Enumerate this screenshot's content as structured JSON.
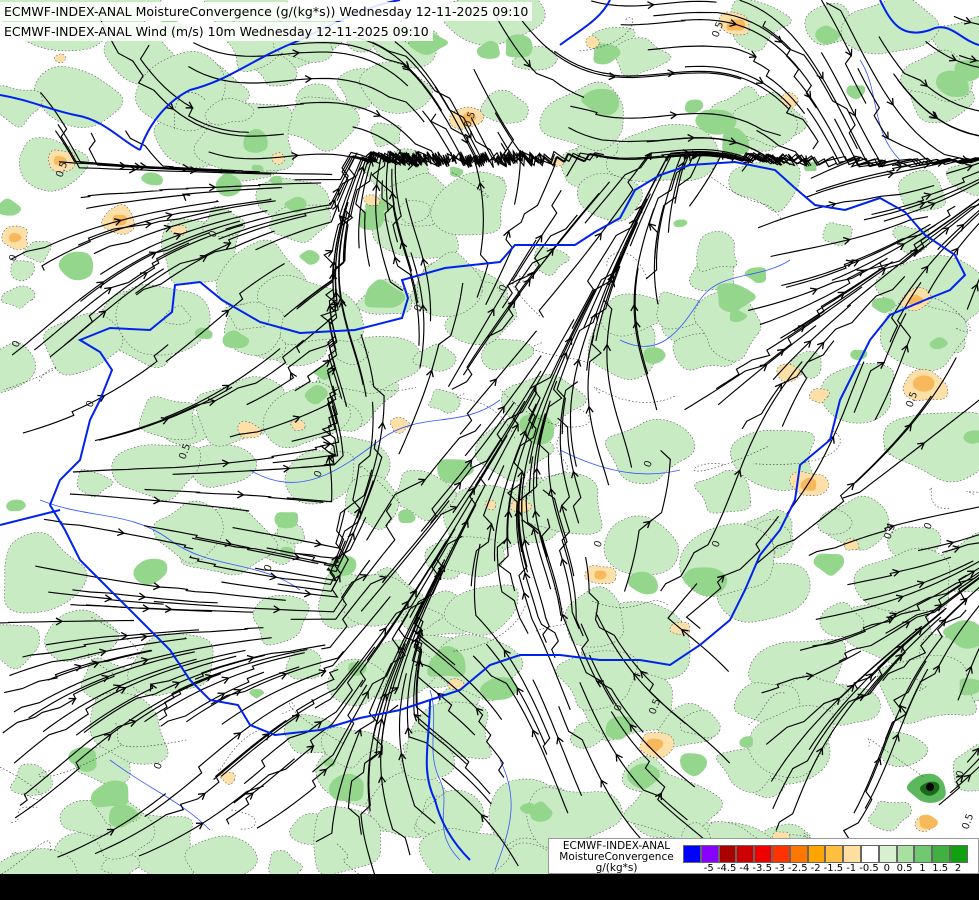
{
  "titles": {
    "line1": "ECMWF-INDEX-ANAL MoistureConvergence (g/(kg*s)) Wednesday 12-11-2025 09:10",
    "line2": "ECMWF-INDEX-ANAL Wind (m/s) 10m Wednesday 12-11-2025 09:10"
  },
  "legend": {
    "line1": "ECMWF-INDEX-ANAL",
    "line2": "MoistureConvergence",
    "line3": "g/(kg*s)",
    "colors": [
      "#0000ff",
      "#8800ff",
      "#aa0000",
      "#cc0000",
      "#ee0000",
      "#ff3300",
      "#ff7700",
      "#ffa500",
      "#ffc040",
      "#ffe0a0",
      "#ffffff",
      "#d8f0d0",
      "#a8e0a0",
      "#70c870",
      "#40b040",
      "#10a010"
    ],
    "ticks": [
      "-5",
      "-4.5",
      "-4",
      "-3.5",
      "-3",
      "-2.5",
      "-2",
      "-1.5",
      "-1",
      "-0.5",
      "0",
      "0.5",
      "1",
      "1.5",
      "2"
    ]
  },
  "map": {
    "contour_labels": [
      {
        "text": "0.5"
      },
      {
        "text": "0.5"
      },
      {
        "text": "0"
      },
      {
        "text": "0.5"
      },
      {
        "text": "0"
      },
      {
        "text": "0"
      },
      {
        "text": "0"
      },
      {
        "text": "0"
      },
      {
        "text": "0.5"
      },
      {
        "text": "0"
      },
      {
        "text": "0"
      },
      {
        "text": "0"
      },
      {
        "text": "0"
      },
      {
        "text": "0"
      },
      {
        "text": "0.5"
      },
      {
        "text": "0"
      },
      {
        "text": "0.5"
      },
      {
        "text": "0"
      },
      {
        "text": "0"
      },
      {
        "text": "0"
      },
      {
        "text": "0.5"
      },
      {
        "text": "0"
      },
      {
        "text": "0.5"
      }
    ],
    "colors": {
      "land_bg": "#ffffff",
      "moist_pos_light": "#c8ebc4",
      "moist_pos_mid": "#94d68c",
      "moist_pos_dark": "#5cb85c",
      "moist_neg_light": "#fde0a8",
      "moist_neg_mid": "#f8b85c",
      "moist_neg_dark": "#e88a20",
      "border": "#0022ee",
      "river": "#3355ff",
      "wind": "#000000",
      "contour": "#333333"
    }
  }
}
